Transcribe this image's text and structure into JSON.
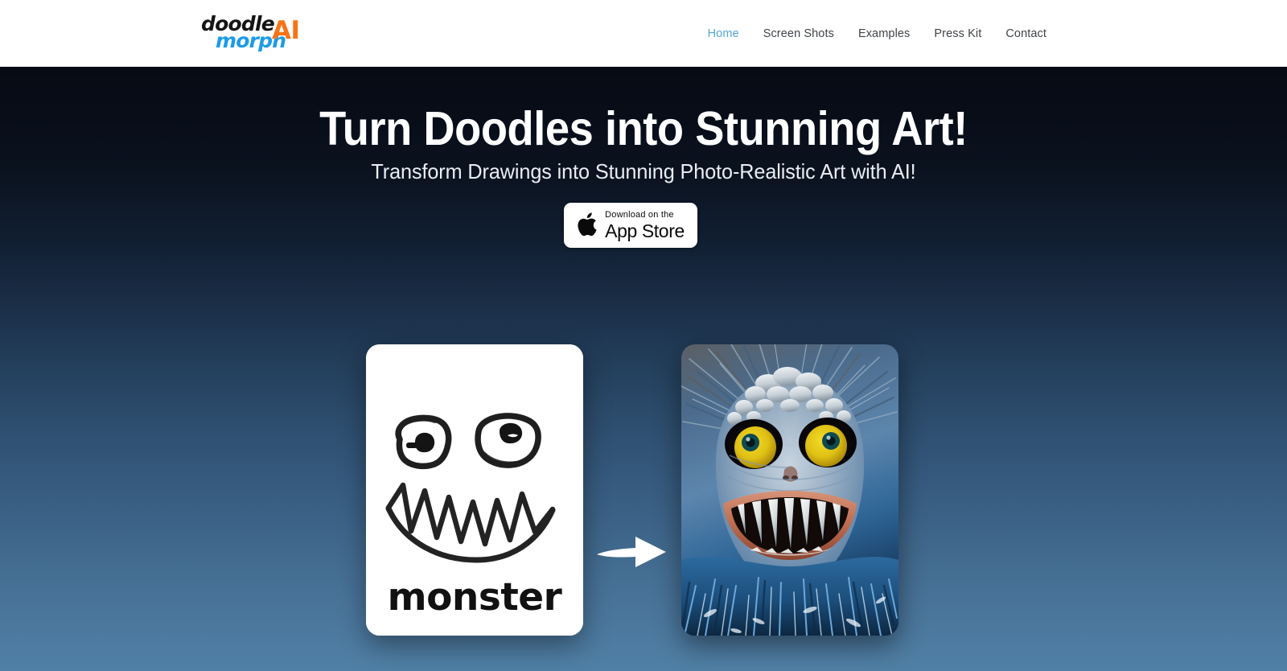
{
  "header": {
    "logo": {
      "name": "doodlemorph AI",
      "part1": "doodle",
      "part2": "morph",
      "part3": "AI",
      "color1": "#141414",
      "color2": "#1C9BE8",
      "color3": "#F97316"
    },
    "nav": {
      "items": [
        {
          "label": "Home",
          "active": true
        },
        {
          "label": "Screen Shots",
          "active": false
        },
        {
          "label": "Examples",
          "active": false
        },
        {
          "label": "Press Kit",
          "active": false
        },
        {
          "label": "Contact",
          "active": false
        }
      ],
      "active_color": "#54A6D8",
      "inactive_color": "#3f4448"
    }
  },
  "hero": {
    "headline": "Turn Doodles into Stunning Art!",
    "subheadline": "Transform Drawings into Stunning Photo-Realistic Art with AI!",
    "background_top_color": "#070b14",
    "background_bottom_color": "#5080a6",
    "cta": {
      "small_label": "Download on the",
      "large_label": "App Store",
      "icon": "apple-logo-icon",
      "background": "#ffffff",
      "text_color": "#0a0a0a"
    },
    "showcase": {
      "before": {
        "type": "doodle",
        "caption": "monster",
        "background": "#ffffff",
        "ink_color": "#1a1a1a"
      },
      "transform_icon": "right-arrow-icon",
      "transform_icon_color": "#ffffff",
      "after": {
        "type": "ai-generated-photo",
        "subject": "blue furry monster with yellow eyes and sharp fangs",
        "eye_color": "#E8C51B",
        "fur_color": "#3E78AC",
        "gum_color": "#C07258"
      }
    }
  }
}
